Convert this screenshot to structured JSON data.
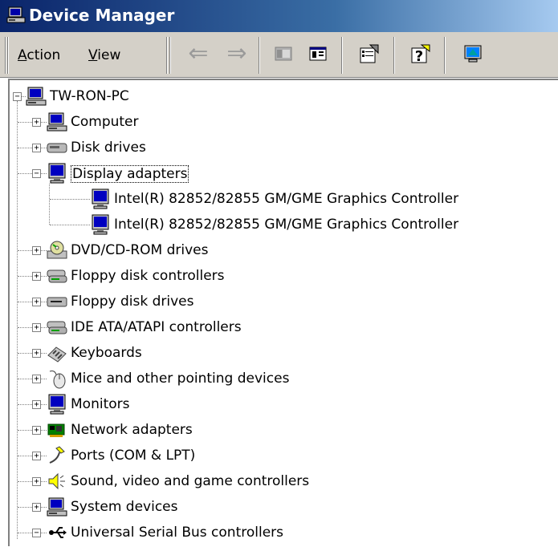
{
  "window": {
    "title": "Device Manager"
  },
  "toolbar": {
    "menus": [
      {
        "label": "Action",
        "accel": "A"
      },
      {
        "label": "View",
        "accel": "V"
      }
    ],
    "buttons": [
      "back-arrow-icon",
      "forward-arrow-icon",
      "console-tree-icon",
      "show-hide-icon",
      "properties-icon",
      "help-icon",
      "scan-hardware-icon"
    ]
  },
  "tree": {
    "root": {
      "label": "TW-RON-PC",
      "icon": "computer-icon",
      "expanded": true
    },
    "items": [
      {
        "label": "Computer",
        "icon": "computer-icon",
        "expanded": false
      },
      {
        "label": "Disk drives",
        "icon": "disk-drive-icon",
        "expanded": false
      },
      {
        "label": "Display adapters",
        "icon": "monitor-icon",
        "expanded": true,
        "selected": true,
        "children": [
          {
            "label": "Intel(R) 82852/82855 GM/GME Graphics Controller",
            "icon": "monitor-icon"
          },
          {
            "label": "Intel(R) 82852/82855 GM/GME Graphics Controller",
            "icon": "monitor-icon"
          }
        ]
      },
      {
        "label": "DVD/CD-ROM drives",
        "icon": "cd-rom-icon",
        "expanded": false
      },
      {
        "label": "Floppy disk controllers",
        "icon": "controller-icon",
        "expanded": false
      },
      {
        "label": "Floppy disk drives",
        "icon": "floppy-drive-icon",
        "expanded": false
      },
      {
        "label": "IDE ATA/ATAPI controllers",
        "icon": "controller-icon",
        "expanded": false
      },
      {
        "label": "Keyboards",
        "icon": "keyboard-icon",
        "expanded": false
      },
      {
        "label": "Mice and other pointing devices",
        "icon": "mouse-icon",
        "expanded": false
      },
      {
        "label": "Monitors",
        "icon": "monitor-icon",
        "expanded": false
      },
      {
        "label": "Network adapters",
        "icon": "network-adapter-icon",
        "expanded": false
      },
      {
        "label": "Ports (COM & LPT)",
        "icon": "port-icon",
        "expanded": false
      },
      {
        "label": "Sound, video and game controllers",
        "icon": "speaker-icon",
        "expanded": false
      },
      {
        "label": "System devices",
        "icon": "computer-icon",
        "expanded": false
      },
      {
        "label": "Universal Serial Bus controllers",
        "icon": "usb-icon",
        "expanded": true
      }
    ]
  }
}
